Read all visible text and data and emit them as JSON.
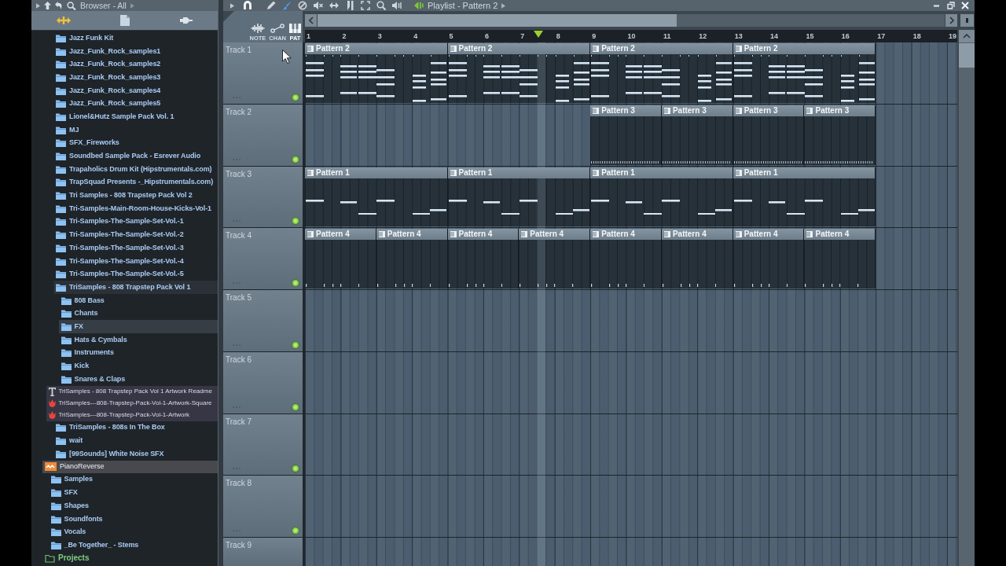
{
  "browser": {
    "title": "Browser - All",
    "tree": [
      {
        "kind": "scrolled-out",
        "children": [
          {
            "kind": "scrolled-out",
            "children": [
              {
                "label": "Jazz Funk Kit",
                "kind": "folder",
                "selected": false,
                "expanded": false
              },
              {
                "label": "Jazz_Funk_Rock_samples1",
                "kind": "folder",
                "selected": false,
                "expanded": false
              },
              {
                "label": "Jazz_Funk_Rock_samples2",
                "kind": "folder",
                "selected": false,
                "expanded": false
              },
              {
                "label": "Jazz_Funk_Rock_samples3",
                "kind": "folder",
                "selected": false,
                "expanded": false
              },
              {
                "label": "Jazz_Funk_Rock_samples4",
                "kind": "folder",
                "selected": false,
                "expanded": false
              },
              {
                "label": "Jazz_Funk_Rock_samples5",
                "kind": "folder",
                "selected": false,
                "expanded": false
              },
              {
                "label": "Lionel&Hutz Sample Pack Vol. 1",
                "kind": "folder",
                "selected": false,
                "expanded": false
              },
              {
                "label": "MJ",
                "kind": "folder",
                "selected": false,
                "expanded": false
              },
              {
                "label": "SFX_Fireworks",
                "kind": "folder",
                "selected": false,
                "expanded": false
              },
              {
                "label": "Soundbed Sample Pack - Esrever Audio",
                "kind": "folder",
                "selected": false,
                "expanded": false
              },
              {
                "label": "Trapaholics Drum Kit (Hipstrumentals.com)",
                "kind": "folder",
                "selected": false,
                "expanded": false
              },
              {
                "label": "TrapSquad Presents -_Hipstrumentals.com)",
                "kind": "folder",
                "selected": false,
                "expanded": false
              },
              {
                "label": "Tri Samples - 808 Trapstep Pack Vol 2",
                "kind": "folder",
                "selected": false,
                "expanded": false
              },
              {
                "label": "Tri-Samples-Main-Room-House-Kicks-Vol-1",
                "kind": "folder",
                "selected": false,
                "expanded": false
              },
              {
                "label": "Tri-Samples-The-Sample-Set-Vol.-1",
                "kind": "folder",
                "selected": false,
                "expanded": false
              },
              {
                "label": "Tri-Samples-The-Sample-Set-Vol.-2",
                "kind": "folder",
                "selected": false,
                "expanded": false
              },
              {
                "label": "Tri-Samples-The-Sample-Set-Vol.-3",
                "kind": "folder",
                "selected": false,
                "expanded": false
              },
              {
                "label": "Tri-Samples-The-Sample-Set-Vol.-4",
                "kind": "folder",
                "selected": false,
                "expanded": false
              },
              {
                "label": "Tri-Samples-The-Sample-Set-Vol.-5",
                "kind": "folder",
                "selected": false,
                "expanded": false
              },
              {
                "label": "TriSamples - 808 Trapstep Pack Vol 1",
                "kind": "folder",
                "selected": false,
                "expanded": true,
                "children": [
                  {
                    "label": "808 Bass",
                    "kind": "folder",
                    "selected": false,
                    "expanded": false
                  },
                  {
                    "label": "Chants",
                    "kind": "folder",
                    "selected": false,
                    "expanded": false
                  },
                  {
                    "label": "FX",
                    "kind": "folder",
                    "selected": true,
                    "expanded": false
                  },
                  {
                    "label": "Hats & Cymbals",
                    "kind": "folder",
                    "selected": false,
                    "expanded": false
                  },
                  {
                    "label": "Instruments",
                    "kind": "folder",
                    "selected": false,
                    "expanded": false
                  },
                  {
                    "label": "Kick",
                    "kind": "folder",
                    "selected": false,
                    "expanded": false
                  },
                  {
                    "label": "Snares & Claps",
                    "kind": "folder",
                    "selected": false,
                    "expanded": false
                  },
                  {
                    "label": "TriSamples - 808 Trapstep Pack Vol 1 Artwork Readme",
                    "kind": "text-file",
                    "selected": false
                  },
                  {
                    "label": "TriSamples---808-Trapstep-Pack-Vol-1-Artwork-Square",
                    "kind": "image-file",
                    "selected": false
                  },
                  {
                    "label": "TriSamples---808-Trapstep-Pack-Vol-1-Artwork",
                    "kind": "image-file",
                    "selected": false
                  }
                ]
              },
              {
                "label": "TriSamples - 808s In The Box",
                "kind": "folder",
                "selected": false,
                "expanded": false
              },
              {
                "label": "wait",
                "kind": "folder",
                "selected": false,
                "expanded": false
              },
              {
                "label": "[99Sounds] White Noise SFX",
                "kind": "folder",
                "selected": false,
                "expanded": false
              },
              {
                "label": "PianoReverse",
                "kind": "project-file",
                "selected": false
              }
            ]
          },
          {
            "label": "Samples",
            "kind": "folder",
            "selected": false,
            "expanded": false
          },
          {
            "label": "SFX",
            "kind": "folder",
            "selected": false,
            "expanded": false
          },
          {
            "label": "Shapes",
            "kind": "folder",
            "selected": false,
            "expanded": false
          },
          {
            "label": "Soundfonts",
            "kind": "folder",
            "selected": false,
            "expanded": false
          },
          {
            "label": "Vocals",
            "kind": "folder",
            "selected": false,
            "expanded": false
          },
          {
            "label": "_Be Together_ - Stems",
            "kind": "folder",
            "selected": false,
            "expanded": false
          }
        ]
      },
      {
        "label": "Projects",
        "kind": "root",
        "selected": false
      }
    ]
  },
  "playlist": {
    "title": "Playlist - Pattern 2",
    "tools": [
      {
        "selected": false
      },
      {
        "selected": true
      },
      {
        "selected": false
      },
      {
        "selected": false
      },
      {
        "selected": false
      },
      {
        "selected": false
      },
      {
        "selected": false
      },
      {
        "selected": false
      },
      {
        "selected": false
      }
    ],
    "filters": [
      {
        "label": "NOTE",
        "selected": false
      },
      {
        "label": "CHAN",
        "selected": false
      },
      {
        "label": "PAT",
        "selected": true
      }
    ],
    "ruler": [
      "1",
      "2",
      "3",
      "4",
      "5",
      "6",
      "7",
      "8",
      "9",
      "10",
      "11",
      "12",
      "13",
      "14",
      "15",
      "16",
      "17",
      "18",
      "19"
    ],
    "playhead": {
      "level": 0.358
    },
    "tracks": [
      {
        "name": "Track 1",
        "on": true,
        "clips": [
          {
            "kind": "chords",
            "label": "Pattern 2"
          },
          {
            "kind": "chords",
            "label": "Pattern 2"
          },
          {
            "kind": "chords",
            "label": "Pattern 2"
          },
          {
            "kind": "chords",
            "label": "Pattern 2"
          }
        ]
      },
      {
        "name": "Track 2",
        "on": true,
        "clips": [
          {
            "kind": "rest"
          },
          {
            "kind": "rest"
          },
          {
            "kind": "hats",
            "label": "Pattern 3"
          },
          {
            "kind": "hats",
            "label": "Pattern 3"
          },
          {
            "kind": "hats",
            "label": "Pattern 3"
          },
          {
            "kind": "hats",
            "label": "Pattern 3"
          }
        ]
      },
      {
        "name": "Track 3",
        "on": true,
        "clips": [
          {
            "kind": "bass",
            "label": "Pattern 1"
          },
          {
            "kind": "bass",
            "label": "Pattern 1"
          },
          {
            "kind": "bass",
            "label": "Pattern 1"
          },
          {
            "kind": "bass",
            "label": "Pattern 1"
          }
        ]
      },
      {
        "name": "Track 4",
        "on": true,
        "clips": [
          {
            "kind": "kick",
            "label": "Pattern 4"
          },
          {
            "kind": "kick",
            "label": "Pattern 4"
          },
          {
            "kind": "kick",
            "label": "Pattern 4"
          },
          {
            "kind": "kick",
            "label": "Pattern 4"
          },
          {
            "kind": "kick",
            "label": "Pattern 4"
          },
          {
            "kind": "kick",
            "label": "Pattern 4"
          },
          {
            "kind": "kick",
            "label": "Pattern 4"
          },
          {
            "kind": "kick",
            "label": "Pattern 4"
          }
        ]
      },
      {
        "name": "Track 5",
        "on": true
      },
      {
        "name": "Track 6",
        "on": true
      },
      {
        "name": "Track 7",
        "on": true
      },
      {
        "name": "Track 8",
        "on": true
      },
      {
        "name": "Track 9"
      }
    ]
  }
}
